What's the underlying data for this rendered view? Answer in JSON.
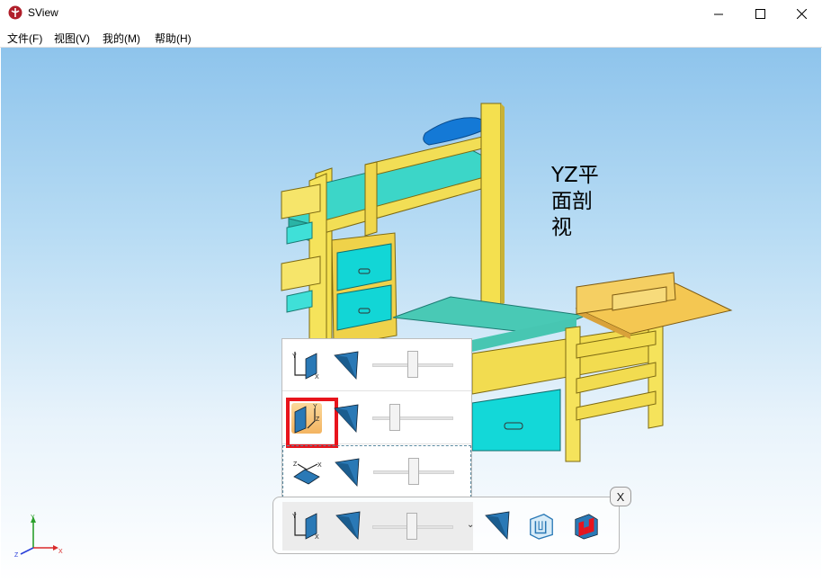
{
  "window": {
    "title": "SView",
    "minimize": "—",
    "maximize": "☐",
    "close": "✕"
  },
  "menu": [
    {
      "label": "文件(F)"
    },
    {
      "label": "视图(V)"
    },
    {
      "label": "我的(M)"
    },
    {
      "label": "帮助(H)"
    }
  ],
  "viewport": {
    "section_label": "YZ平面剖视",
    "label_lines": [
      "YZ平",
      "面剖",
      "视"
    ]
  },
  "section_panel": {
    "rows": [
      {
        "plane": "XY",
        "icon": "xy-plane-icon",
        "axes": [
          "Y",
          "X"
        ],
        "slider_value": 0.5
      },
      {
        "plane": "YZ",
        "icon": "yz-plane-icon",
        "axes": [
          "Y",
          "Z"
        ],
        "slider_value": 0.3,
        "selected": true
      },
      {
        "plane": "ZX",
        "icon": "zx-plane-icon",
        "axes": [
          "Z",
          "X"
        ],
        "slider_value": 0.5
      }
    ]
  },
  "toolbar": {
    "combo_axes": [
      "Y",
      "X"
    ],
    "dropdown_arrow": "⌄",
    "close_label": "X"
  },
  "triad": {
    "x": "X",
    "y": "Y",
    "z": "Z"
  },
  "colors": {
    "accent_highlight": "#e8141c",
    "model_yellow": "#f5e25a",
    "model_cyan": "#2fd8d8",
    "model_blue": "#1478d4",
    "icon_blue": "#2a79b6"
  }
}
